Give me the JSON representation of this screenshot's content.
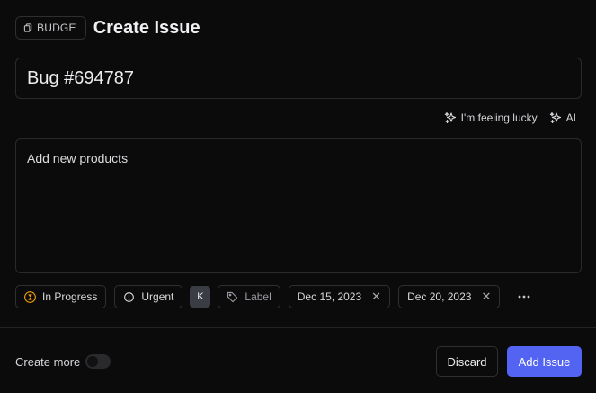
{
  "header": {
    "project_badge": "BUDGE",
    "title": "Create Issue"
  },
  "issue": {
    "title_value": "Bug #694787",
    "description_value": "Add new products"
  },
  "ai_actions": {
    "lucky_label": "I'm feeling lucky",
    "ai_label": "AI"
  },
  "properties": {
    "status": "In Progress",
    "priority": "Urgent",
    "assignee_initial": "K",
    "label_placeholder": "Label",
    "start_date": "Dec 15, 2023",
    "due_date": "Dec 20, 2023"
  },
  "footer": {
    "create_more_label": "Create more",
    "create_more_enabled": false,
    "discard_label": "Discard",
    "add_label": "Add Issue"
  },
  "colors": {
    "background": "#0b0b0c",
    "primary": "#5364f2",
    "status_in_progress": "#f59e0b"
  }
}
